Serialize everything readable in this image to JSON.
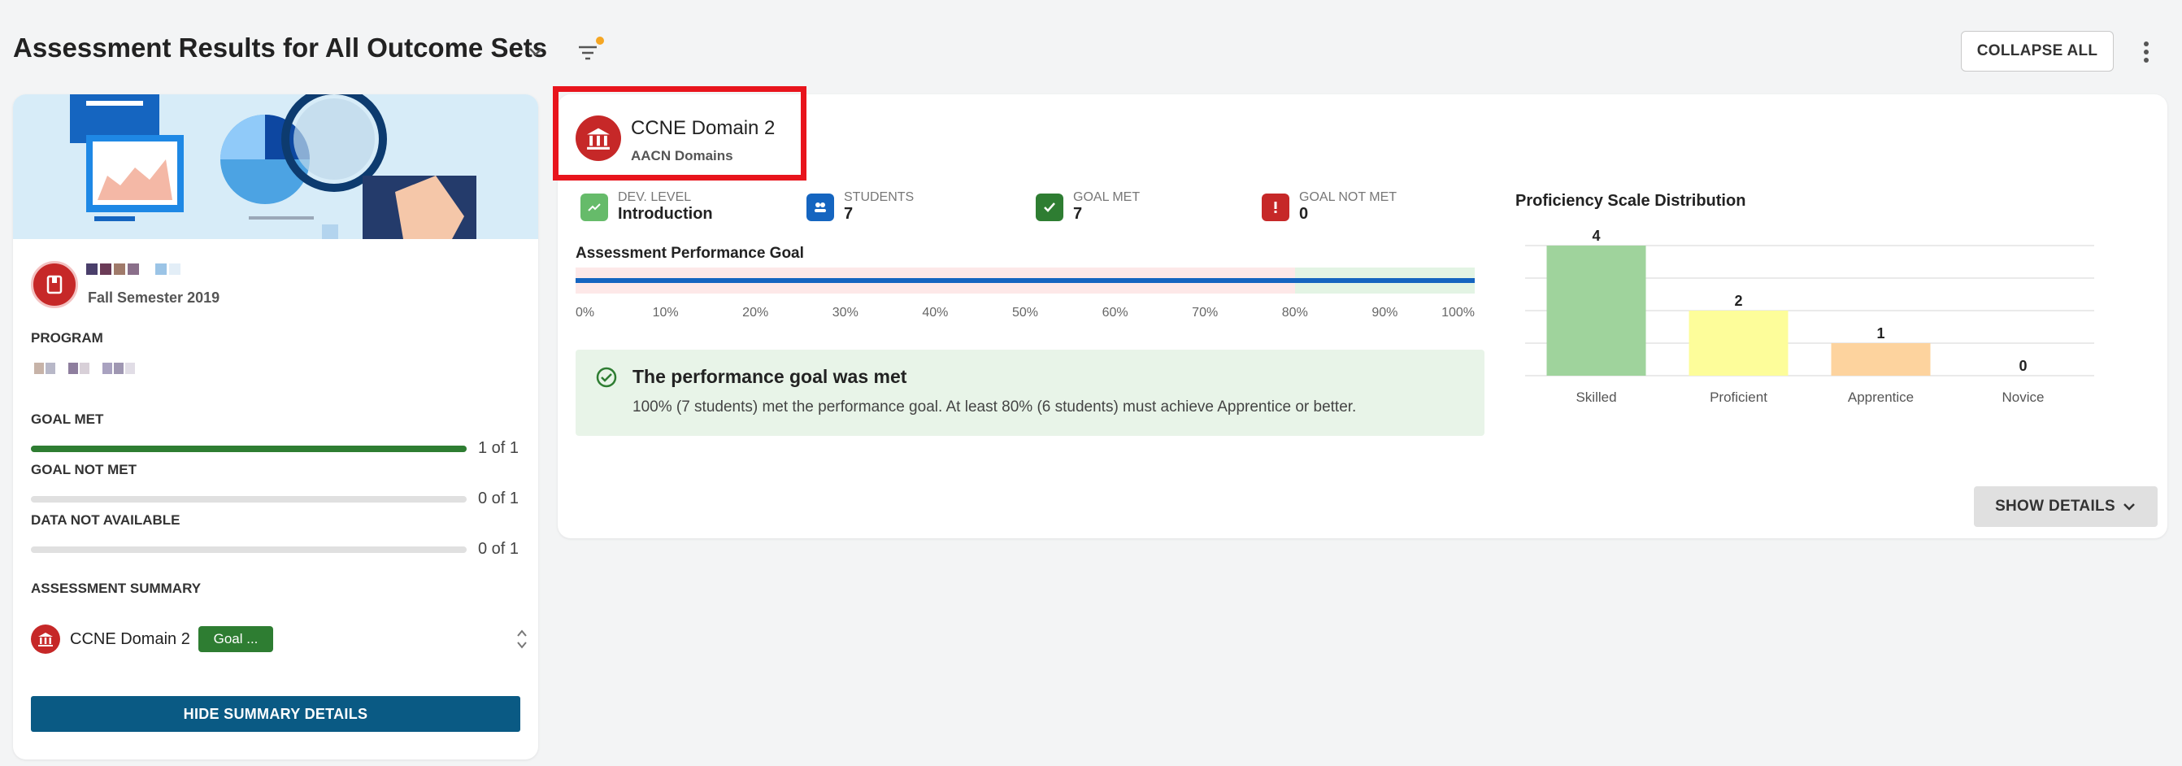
{
  "header": {
    "title": "Assessment Results for All Outcome Sets",
    "collapse_label": "COLLAPSE ALL"
  },
  "left_card": {
    "semester": "Fall Semester 2019",
    "program_label": "PROGRAM",
    "goal_met": {
      "label": "GOAL MET",
      "count": "1 of 1",
      "fraction": 1.0
    },
    "goal_not_met": {
      "label": "GOAL NOT MET",
      "count": "0 of 1",
      "fraction": 0
    },
    "data_not_available": {
      "label": "DATA NOT AVAILABLE",
      "count": "0 of 1",
      "fraction": 0
    },
    "summary_label": "ASSESSMENT SUMMARY",
    "summary_item": {
      "name": "CCNE Domain 2",
      "chip": "Goal ..."
    },
    "hide_label": "HIDE SUMMARY DETAILS"
  },
  "main_card": {
    "domain_name": "CCNE Domain 2",
    "domain_sub": "AACN Domains",
    "stats": [
      {
        "label": "DEV. LEVEL",
        "value": "Introduction",
        "icon": "trend-up-icon",
        "color": "#66bb6a"
      },
      {
        "label": "STUDENTS",
        "value": "7",
        "icon": "students-icon",
        "color": "#1565c0"
      },
      {
        "label": "GOAL MET",
        "value": "7",
        "icon": "check-icon",
        "color": "#2e7d32"
      },
      {
        "label": "GOAL NOT MET",
        "value": "0",
        "icon": "alert-icon",
        "color": "#c62828"
      }
    ],
    "perf_title": "Assessment Performance Goal",
    "perf_ticks": [
      "0%",
      "10%",
      "20%",
      "30%",
      "40%",
      "50%",
      "60%",
      "70%",
      "80%",
      "90%",
      "100%"
    ],
    "perf_goal_percent": 80,
    "perf_actual_percent": 100,
    "goal_head": "The performance goal was met",
    "goal_text": "100% (7 students) met the performance goal. At least 80% (6 students) must achieve Apprentice or better.",
    "dist_title": "Proficiency Scale Distribution",
    "show_label": "SHOW DETAILS"
  },
  "chart_data": {
    "type": "bar",
    "title": "Proficiency Scale Distribution",
    "categories": [
      "Skilled",
      "Proficient",
      "Apprentice",
      "Novice"
    ],
    "values": [
      4,
      2,
      1,
      0
    ],
    "colors": [
      "#9fd39c",
      "#fdfd9a",
      "#fdd39e",
      "#e0e0e0"
    ],
    "ylim": [
      0,
      4
    ]
  }
}
